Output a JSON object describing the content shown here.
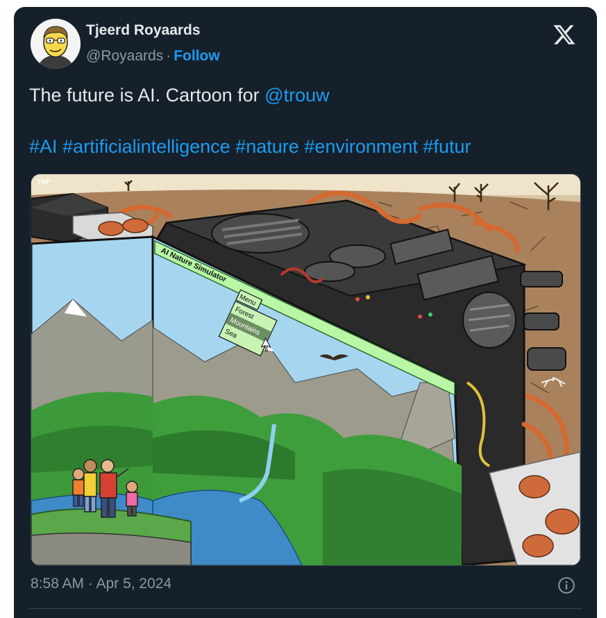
{
  "author": {
    "name": "Tjeerd Royaards",
    "handle": "@Royaards",
    "separator": "·",
    "follow_label": "Follow"
  },
  "tweet": {
    "text": "The future is AI. Cartoon for ",
    "mention": "@trouw",
    "hashtags": [
      "#AI",
      "#artificialintelligence",
      "#nature",
      "#environment",
      "#futur"
    ]
  },
  "media": {
    "signature": "TWP",
    "screen_title": "AI Nature Simulator",
    "menu_label": "Menu",
    "menu_items": [
      "Forest",
      "Mountains",
      "Sea"
    ],
    "selected_item": "Mountains"
  },
  "footer": {
    "timestamp": "8:58 AM · Apr 5, 2024"
  },
  "icons": {
    "close": "x-logo-icon",
    "info": "info-icon"
  },
  "colors": {
    "background": "#15202b",
    "text": "#e7e9ea",
    "muted": "#8b98a5",
    "accent": "#1d9bf0",
    "screen_green": "#b9f7a6"
  }
}
